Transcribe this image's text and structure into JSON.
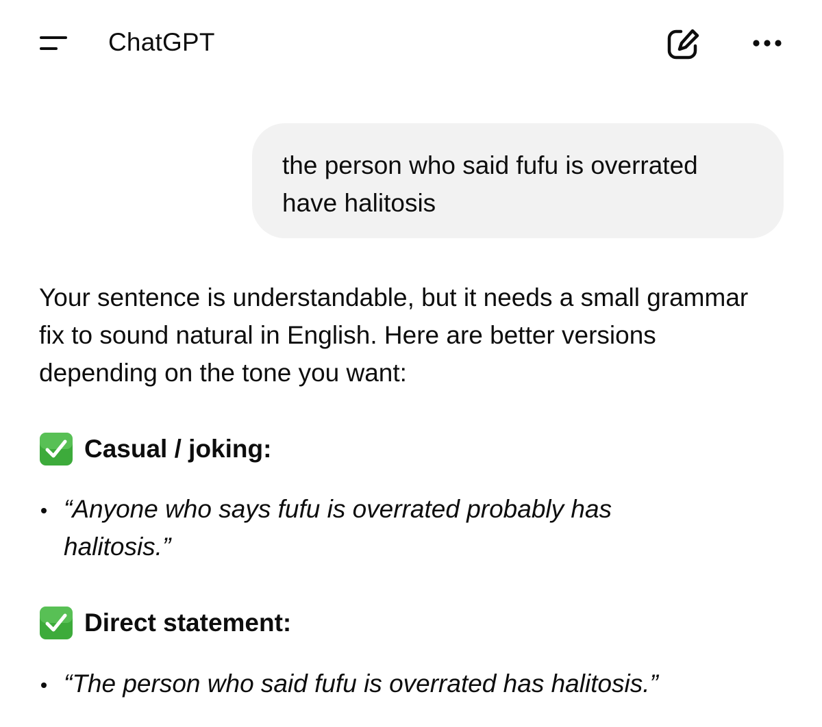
{
  "header": {
    "title": "ChatGPT",
    "icons": {
      "menu": "menu-icon",
      "new_chat": "compose-icon",
      "more": "more-icon"
    }
  },
  "conversation": {
    "user_message": "the person who said fufu is overrated have halitosis",
    "assistant": {
      "intro": "Your sentence is understandable, but it needs a small grammar fix to sound natural in English. Here are better versions depending on the tone you want:",
      "sections": [
        {
          "icon": "check-mark-emoji",
          "heading": "Casual / joking:",
          "bullets": [
            "“Anyone who says fufu is overrated probably has halitosis.”"
          ]
        },
        {
          "icon": "check-mark-emoji",
          "heading": "Direct statement:",
          "bullets": [
            "“The person who said fufu is overrated has halitosis.”"
          ]
        }
      ]
    }
  },
  "colors": {
    "text": "#0d0d0d",
    "user_bubble": "#f2f2f2",
    "check_green": "#3dab3b"
  }
}
